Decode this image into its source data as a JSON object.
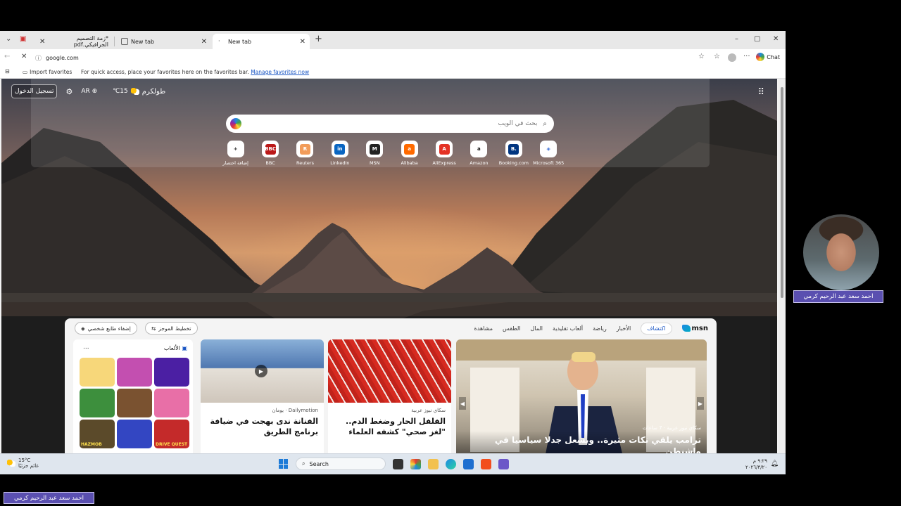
{
  "browser": {
    "tabs": [
      {
        "label": "*زمة التصميم الجرافيكي.pdf",
        "active": false
      },
      {
        "label": "New tab",
        "active": false
      },
      {
        "label": "New tab",
        "active": true
      }
    ],
    "new_tab_symbol": "+",
    "window_controls": {
      "minimize": "–",
      "maximize": "▢",
      "close": "✕"
    },
    "address": "google.com",
    "chat_label": "Chat",
    "favorites_bar": {
      "import_label": "Import favorites",
      "message": "For quick access, place your favorites here on the favorites bar.",
      "manage_link": "Manage favorites now"
    }
  },
  "newtab": {
    "signin_label": "تسجيل الدخول",
    "language_label": "AR",
    "temperature": "15℃",
    "location": "طولكرم",
    "search_placeholder": "بحث في الويب",
    "quick_links": [
      {
        "label": "إضافة اختصار",
        "glyph": "+",
        "color": "#ffffff",
        "fg": "#333333"
      },
      {
        "label": "BBC",
        "glyph": "BBC",
        "color": "#bb1919",
        "fg": "#ffffff"
      },
      {
        "label": "Reuters",
        "glyph": "R",
        "color": "#f29c5a",
        "fg": "#ffffff"
      },
      {
        "label": "LinkedIn",
        "glyph": "in",
        "color": "#0a66c2",
        "fg": "#ffffff"
      },
      {
        "label": "MSN",
        "glyph": "M",
        "color": "#222222",
        "fg": "#ffffff"
      },
      {
        "label": "Alibaba",
        "glyph": "a",
        "color": "#ff6a00",
        "fg": "#ffffff"
      },
      {
        "label": "AliExpress",
        "glyph": "A",
        "color": "#e43225",
        "fg": "#ffffff"
      },
      {
        "label": "Amazon",
        "glyph": "a",
        "color": "#ffffff",
        "fg": "#111111"
      },
      {
        "label": "Booking.com",
        "glyph": "B.",
        "color": "#003580",
        "fg": "#ffffff"
      },
      {
        "label": "Microsoft 365",
        "glyph": "◈",
        "color": "#ffffff",
        "fg": "#3b6fd8"
      }
    ],
    "feed": {
      "logo": "msn",
      "nav": [
        "اكتشاف",
        "الأخبار",
        "رياضة",
        "ألعاب تقليدية",
        "المال",
        "الطقس",
        "مشاهدة"
      ],
      "active_nav": "اكتشاف",
      "personalize_label": "إضفاء طابع شخصي",
      "layout_label": "تخطيط الموجز",
      "games": {
        "title": "الألعاب",
        "more": "...",
        "tile_colors": [
          "#f7d77a",
          "#c34fb0",
          "#4b1fa3",
          "#3d8f3d",
          "#7a5230",
          "#e86fa7",
          "#5b4a2a",
          "#3346c2",
          "#c42a2a"
        ],
        "tile_texts": [
          "",
          "",
          "",
          "",
          "",
          "",
          "HAZMOB",
          "",
          "DRIVE QUEST"
        ]
      },
      "cards": [
        {
          "source": "Dailymotion · يومان",
          "title": "الفنانة ندى بهجت في ضيافة برنامج الطريق"
        },
        {
          "source": "سكاي نيوز عربية",
          "title": "الفلفل الحار وضغط الدم.. \"لغز صحي\" كشفه العلماء"
        },
        {
          "source": "سكاي نيوز عربية · 7 ساعات",
          "title": "ترامب يلقي نكات مثيرة.. ويشعل جدلا سياسيا في واشنطن"
        }
      ]
    }
  },
  "taskbar": {
    "weather_temp": "15°C",
    "weather_text": "غائم جزئيًا",
    "search_label": "Search",
    "clock_time": "٩:٢٩ م",
    "clock_date": "٢٠٢٦/٣/٢٠"
  },
  "overlay": {
    "presenter_name": "احمد سعد عبد الرحيم كرمي",
    "footer_name": "احمد سعد عبد الرحيم كرمي"
  }
}
